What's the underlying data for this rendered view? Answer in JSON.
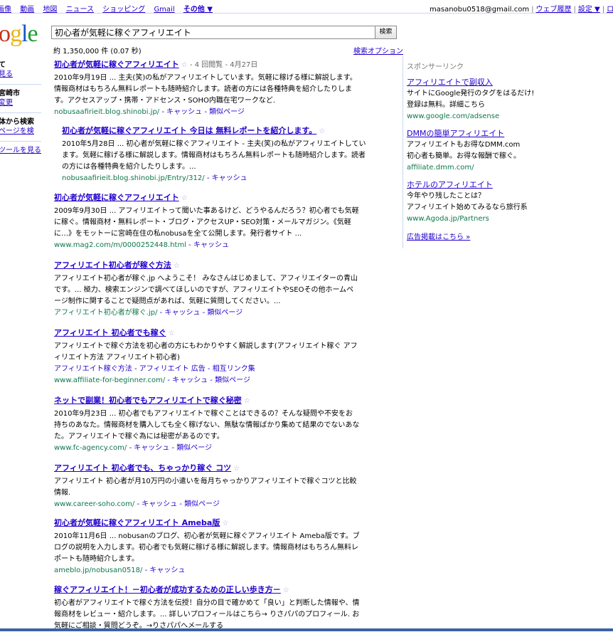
{
  "topnav": {
    "items": [
      "画像",
      "動画",
      "地図",
      "ニュース",
      "ショッピング",
      "Gmail"
    ],
    "more": "その他 ▼"
  },
  "user": {
    "email": "masanobu0518@gmail.com",
    "history": "ウェブ履歴",
    "settings": "設定 ▼",
    "logout": "ログ"
  },
  "logo": "oogle",
  "search": {
    "query": "初心者が気軽に稼ぐアフィリエイト",
    "button": "検索",
    "stats": "約 1,350,000 件 (0.07 秒)",
    "options": "検索オプション"
  },
  "leftnav": {
    "l1": "て",
    "l2": "見る",
    "l3": "宮崎市",
    "l4": "変更",
    "l5": "体から検索",
    "l6": "ページを検",
    "l7": "ツールを見る"
  },
  "results": [
    {
      "title": "初心者が気軽に稼ぐアフィリエイト",
      "meta": "- 4 回閲覧 - 4月27日",
      "snippet": "2010年9月19日 ... 主夫(笑)の私がアフィリエイトしています。気軽に稼げる様に解説します。情報商材はもちろん無料レポートも随時紹介します。読者の方には各種特典を紹介したりします。アクセスアップ・携帯・アドセンス・SOHO内職在宅ワークなど.",
      "url": "nobusaafirieit.blog.shinobi.jp/",
      "links": "- キャッシュ - 類似ページ"
    },
    {
      "title": "初心者が気軽に稼ぐアフィリエイト 今日は 無料レポートを紹介します。",
      "meta": "",
      "snippet": "2010年5月28日 ... 初心者が気軽に稼ぐアフィリエイト - 主夫(笑)の私がアフィリエイトしています。気軽に稼げる様に解説します。情報商材はもちろん無料レポートも随時紹介します。読者の方には各種特典を紹介したりします。...",
      "url": "nobusaafirieit.blog.shinobi.jp/Entry/312/",
      "links": "- キャッシュ"
    },
    {
      "title": "初心者が気軽に稼ぐアフィリエイト",
      "meta": "",
      "snippet": "2009年9月30日 ... アフィリエイトって聞いた事あるけど、どうやるんだろう？初心者でも気軽に稼ぐ。情報商材・無料レポート・ブログ・アクセスUP・SEO対策・メールマガジン。《気軽に…》をモットーに宮崎在住の私nobusaを全て公開します。発行者サイト ...",
      "url": "www.mag2.com/m/0000252448.html",
      "links": "- キャッシュ"
    },
    {
      "title": "アフィリエイト初心者が稼ぐ方法",
      "meta": "",
      "snippet": "アフィリエイト初心者が稼ぐ.jp へようこそ！ みなさんはじめまして、アフィリエイターの青山です。... 極力、検索エンジンで調べてほしいのですが、アフィリエイトやSEOその他ホームページ制作に関することで疑問点があれば、気軽に質問してください。...",
      "url": "アフィリエイト初心者が稼ぐ.jp/",
      "links": "- キャッシュ - 類似ページ"
    },
    {
      "title": "アフィリエイト 初心者でも稼ぐ",
      "meta": "",
      "snippet": "アフィリエイトで稼ぐ方法を初心者の方にもわかりやすく解説します(アフィリエイト稼ぐ アフィリエイト方法 アフィリエイト初心者)",
      "sublinks": "アフィリエイト稼ぐ方法 - アフィリエイト 広告 - 相互リンク集",
      "url": "www.affiliate-for-beginner.com/",
      "links": "- キャッシュ - 類似ページ"
    },
    {
      "title": "ネットで副業！初心者でもアフィリエイトで稼ぐ秘密",
      "meta": "",
      "snippet": "2010年9月23日 ... 初心者でもアフィリエイトで稼ぐことはできるの？そんな疑問や不安をお持ちのあなた。情報商材を購入しても全く稼げない、無駄な情報ばかり集めて結果のでないあなた。アフィリエイトで稼ぐ為には秘密があるのです。",
      "url": "www.fc-agency.com/",
      "links": "- キャッシュ - 類似ページ"
    },
    {
      "title": "アフィリエイト 初心者でも、ちゃっかり稼ぐ コツ",
      "meta": "",
      "snippet": "アフィリエイト 初心者が月10万円の小遣いを毎月ちゃっかりアフィリエイトで稼ぐコツと比較 情報.",
      "url": "www.career-soho.com/",
      "links": "- キャッシュ - 類似ページ"
    },
    {
      "title": "初心者が気軽に稼ぐアフィリエイト Ameba版",
      "meta": "",
      "snippet": "2010年11月6日 ... nobusanのブログ、初心者が気軽に稼ぐアフィリエイト Ameba版です。ブログの説明を入力します。初心者でも気軽に稼げる様に解説します。情報商材はもちろん無料レポートも随時紹介します。",
      "url": "ameblo.jp/nobusan0518/",
      "links": "- キャッシュ"
    },
    {
      "title": "稼ぐアフィリエイト！－初心者が成功するための正しい歩き方－",
      "meta": "",
      "snippet": "初心者がアフィリエイトで稼ぐ方法を伝授！自分の目で確かめて「良い」と判断した情報や、情報商材をレビュー・紹介します。... 詳しいプロフィールはこちら→ りさパパのプロフィール. お気軽にご相談・質問どうぞ。→りさパパへメールする",
      "url": "",
      "links": ""
    }
  ],
  "ads": {
    "title": "スポンサーリンク",
    "items": [
      {
        "headline": "アフィリエイトで副収入",
        "line1": "サイトにGoogle発行のタグをはるだけ!",
        "line2": "登録は無料。詳細こちら",
        "url": "www.google.com/adsense"
      },
      {
        "headline": "DMMの簡単アフィリエイト",
        "line1": "アフィリエイトもお得なDMM.com",
        "line2": "初心者も簡単。お得な報酬で稼ぐ。",
        "url": "affiliate.dmm.com/"
      },
      {
        "headline": "ホテルのアフィリエイト",
        "line1": "今年やり残したことは？",
        "line2": "アフィリエイト始めてみるなら旅行系",
        "url": "www.Agoda.jp/Partners"
      }
    ],
    "more": "広告掲載はこちら »"
  }
}
